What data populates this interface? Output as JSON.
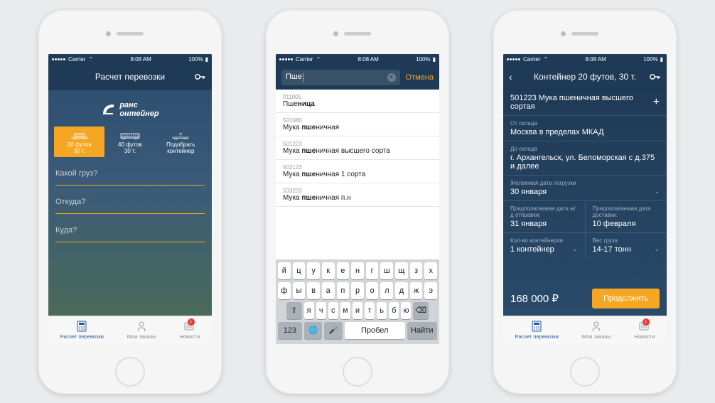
{
  "status": {
    "carrier": "Carrier",
    "time": "8:08 AM",
    "battery": "100%"
  },
  "brand": {
    "line1": "ранс",
    "line2": "онтейнер"
  },
  "screen1": {
    "title": "Расчет перевозки",
    "seg": [
      {
        "l1": "20 футов",
        "l2": "30 т."
      },
      {
        "l1": "40 футов",
        "l2": "30 т."
      },
      {
        "l1": "Подобрать",
        "l2": "контейнер"
      }
    ],
    "fields": {
      "cargo": "Какой груз?",
      "from": "Откуда?",
      "to": "Куда?"
    }
  },
  "screen2": {
    "query": "Пше",
    "cancel": "Отмена",
    "rows": [
      {
        "code": "011005",
        "pre": "Пше",
        "bold": "ница",
        "post": ""
      },
      {
        "code": "501080",
        "pre": "Мука ",
        "bold": "пше",
        "post": "ничная"
      },
      {
        "code": "501223",
        "pre": "Мука ",
        "bold": "пше",
        "post": "ничная высшего сорта"
      },
      {
        "code": "502123",
        "pre": "Мука ",
        "bold": "пше",
        "post": "ничная 1 сорта"
      },
      {
        "code": "533233",
        "pre": "Мука ",
        "bold": "пше",
        "post": "ничная п.н"
      }
    ],
    "keys": {
      "r1": [
        "й",
        "ц",
        "у",
        "к",
        "е",
        "н",
        "г",
        "ш",
        "щ",
        "з",
        "х"
      ],
      "r2": [
        "ф",
        "ы",
        "в",
        "а",
        "п",
        "р",
        "о",
        "л",
        "д",
        "ж",
        "э"
      ],
      "r3": [
        "я",
        "ч",
        "с",
        "м",
        "и",
        "т",
        "ь",
        "б",
        "ю"
      ],
      "num": "123",
      "space": "Пробел",
      "find": "Найти"
    }
  },
  "screen3": {
    "title": "Контейнер 20 футов, 30 т.",
    "cargo": "501223 Мука пшеничная высшего сортая",
    "from_label": "От склада",
    "from": "Москва в пределах МКАД",
    "to_label": "До склада",
    "to": "г. Архангельск, ул. Беломорская с д.375 и далее",
    "date_label": "Желаемая дата погрузки",
    "date": "30 января",
    "ship_label": "Предполагаемая дата ж/д отправки:",
    "ship": "31 января",
    "arrive_label": "Предполагаемая дата доставки:",
    "arrive": "10 февраля",
    "qty_label": "Кол-во контейнеров",
    "qty": "1 контейнер",
    "weight_label": "Вес груза",
    "weight": "14-17 тонн",
    "price": "168 000 ₽",
    "continue": "Продолжить"
  },
  "tabs": {
    "t1": "Расчет перевозки",
    "t2": "Мои заказы",
    "t3": "Новости",
    "badge": "1"
  }
}
